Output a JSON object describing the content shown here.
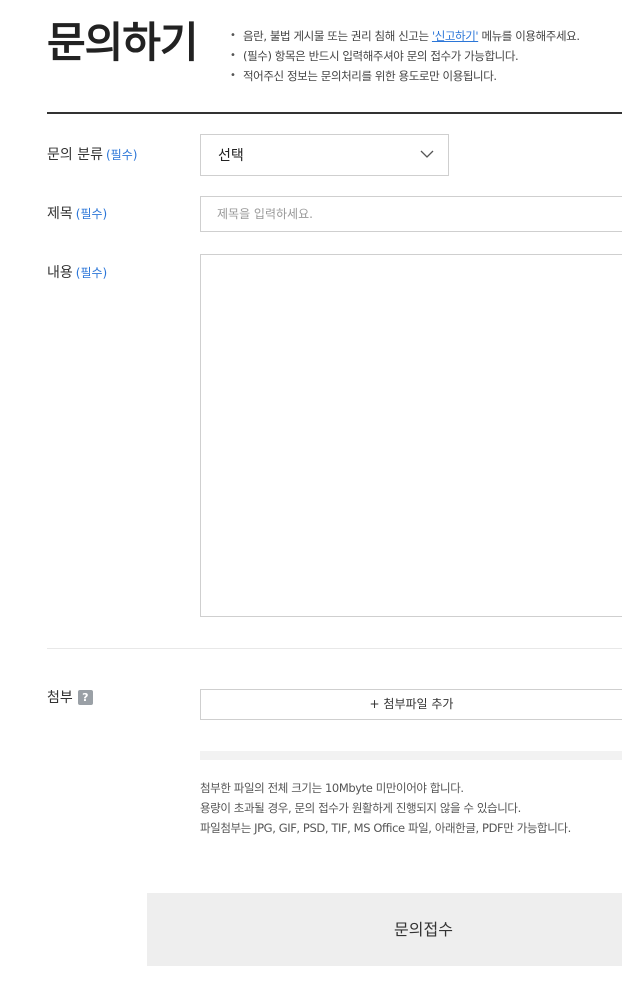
{
  "page": {
    "title": "문의하기"
  },
  "notes": {
    "item1_prefix": "음란, 불법 게시물 또는 권리 침해 신고는 ",
    "item1_link": "'신고하기'",
    "item1_suffix": " 메뉴를 이용해주세요.",
    "item2": "(필수) 항목은 반드시 입력해주셔야 문의 접수가 가능합니다.",
    "item3": "적어주신 정보는 문의처리를 위한 용도로만 이용됩니다."
  },
  "form": {
    "required_tag": "(필수)",
    "category": {
      "label": "문의 분류",
      "selected": "선택"
    },
    "subject": {
      "label": "제목",
      "value": "",
      "placeholder": "제목을 입력하세요."
    },
    "content": {
      "label": "내용",
      "value": ""
    },
    "attachment": {
      "label": "첨부",
      "help_glyph": "?",
      "button_label": "+ 첨부파일 추가",
      "notes": [
        "첨부한 파일의 전체 크기는 10Mbyte 미만이어야 합니다.",
        "용량이 초과될 경우, 문의 접수가 원활하게 진행되지 않을 수 있습니다.",
        "파일첨부는 JPG, GIF, PSD, TIF, MS Office 파일, 아래한글, PDF만 가능합니다."
      ]
    },
    "submit_label": "문의접수"
  },
  "icons": {
    "select_arrow": "chevron-down-icon",
    "attach_help": "help-icon"
  },
  "colors": {
    "accent": "#2b76d8",
    "rule": "#333333",
    "border": "#cfcfcf",
    "submit_bg": "#eeeeee"
  }
}
